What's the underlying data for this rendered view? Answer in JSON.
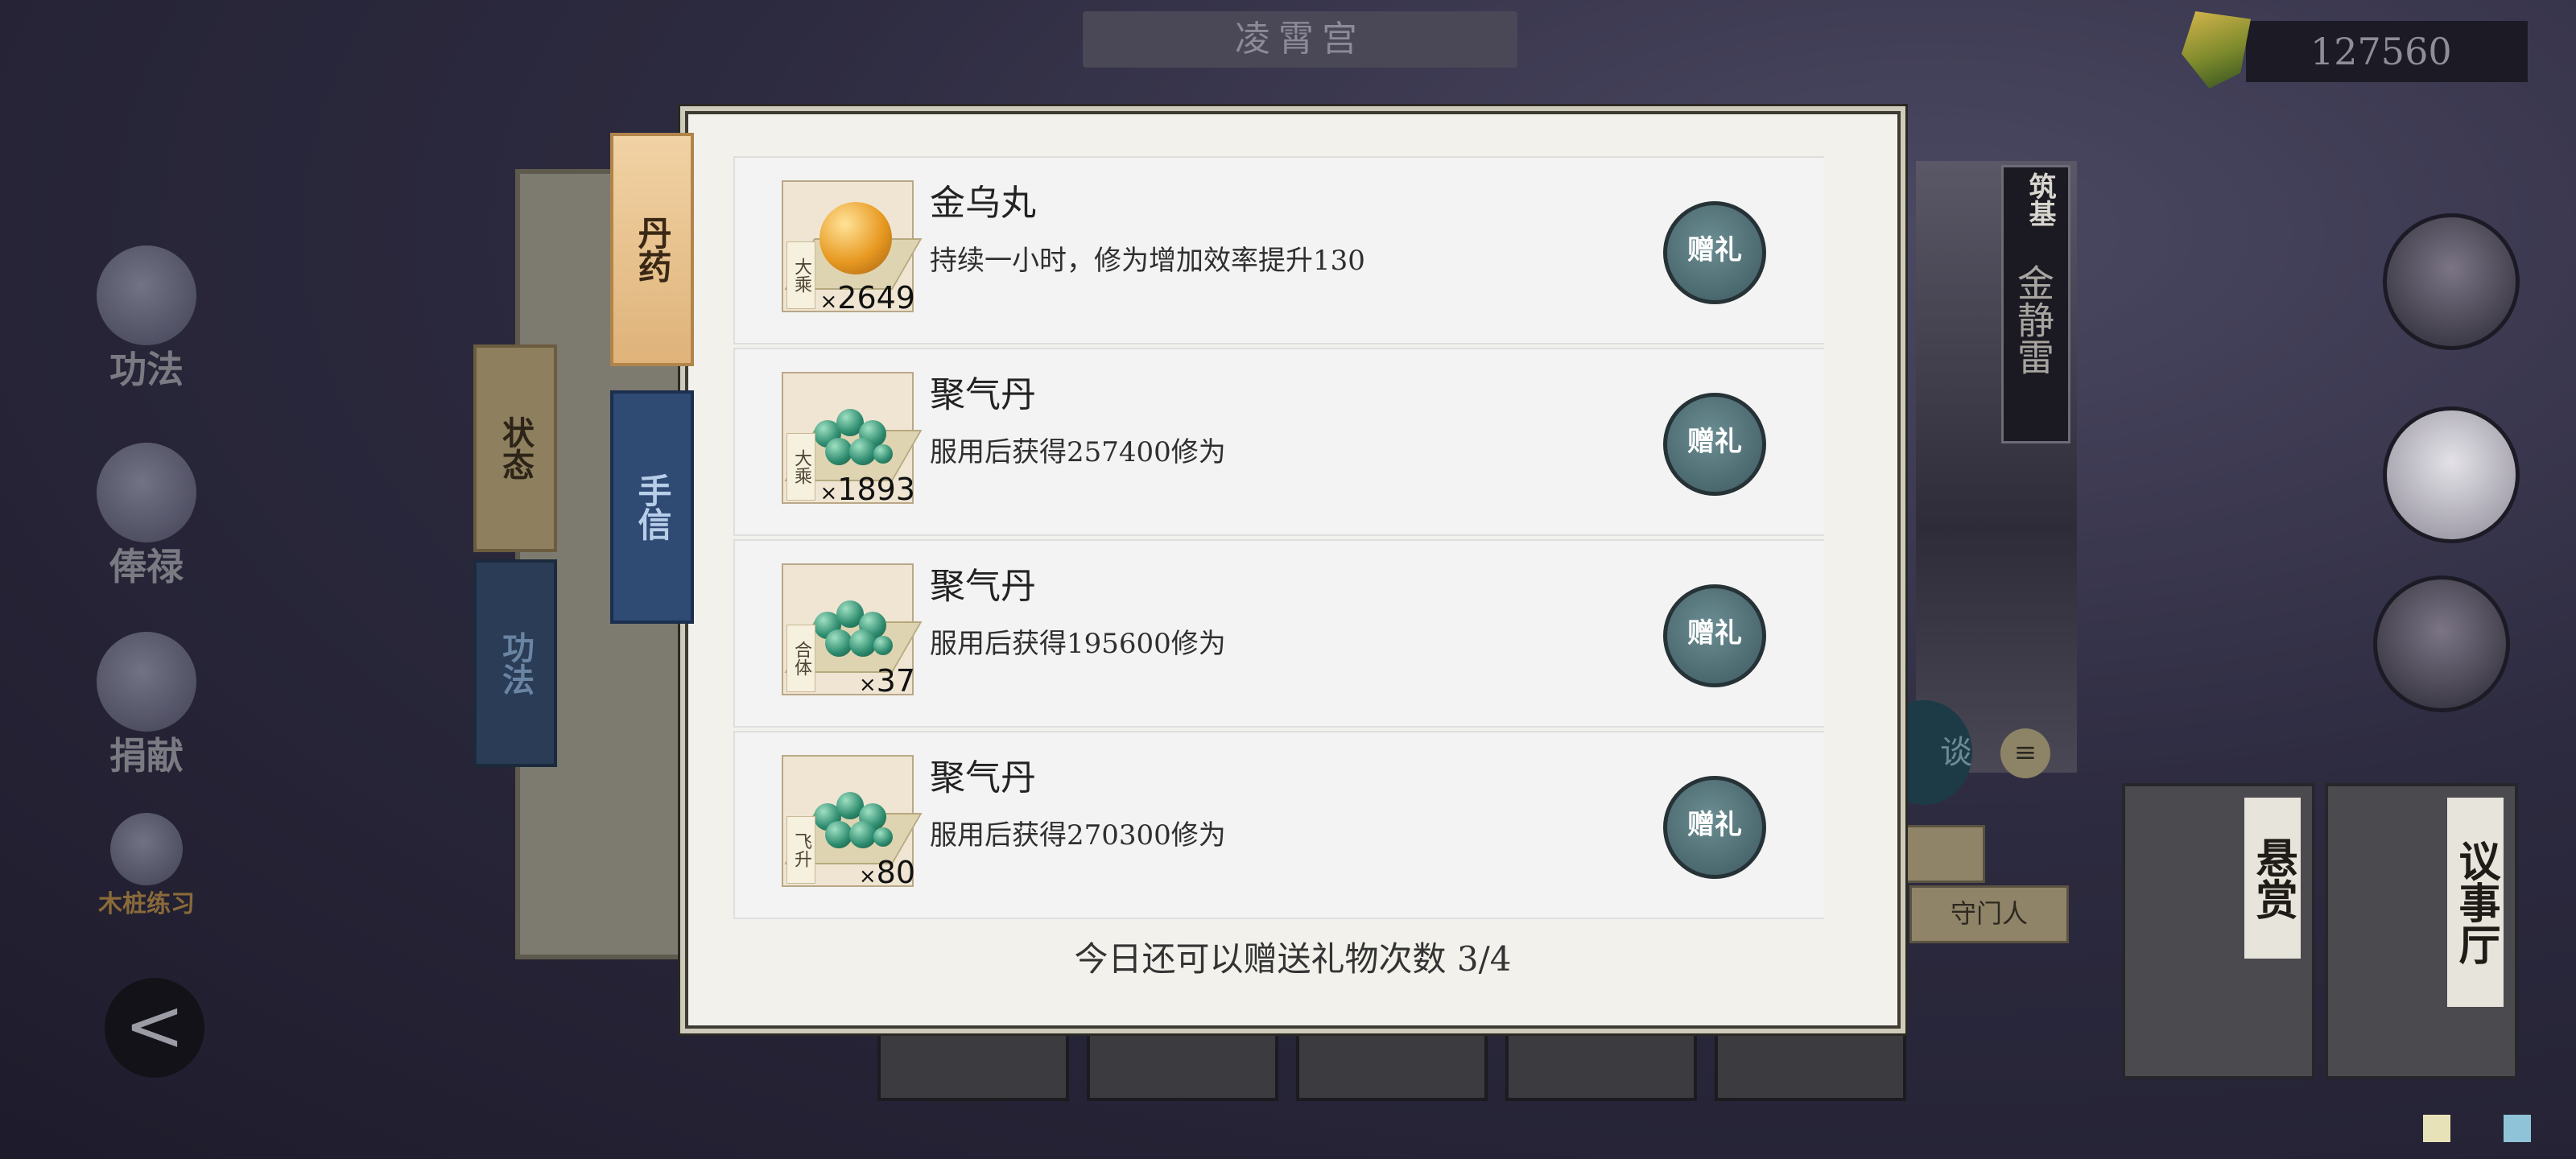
{
  "header": {
    "location_title": "凌霄宫",
    "currency_value": "127560",
    "currency_icon": "jade-token-icon"
  },
  "left_menu": [
    {
      "label": "功法",
      "icon": "scroll-icon"
    },
    {
      "label": "俸禄",
      "icon": "hand-icon"
    },
    {
      "label": "捐献",
      "icon": "pouch-icon"
    },
    {
      "label": "木桩练习",
      "icon": "wood-dummy-icon"
    }
  ],
  "back_label": "<",
  "side_tabs": {
    "state": "状态",
    "gongfa": "功法"
  },
  "dialog_tabs": {
    "danyao": "丹药",
    "shouxin": "手信"
  },
  "items": [
    {
      "name": "金乌丸",
      "desc": "持续一小时，修为增加效率提升130",
      "rank": "大乘",
      "count": "2649",
      "icon": "golden-pill-icon",
      "button": "赠礼"
    },
    {
      "name": "聚气丹",
      "desc": "服用后获得257400修为",
      "rank": "大乘",
      "count": "1893",
      "icon": "green-pills-icon",
      "button": "赠礼"
    },
    {
      "name": "聚气丹",
      "desc": "服用后获得195600修为",
      "rank": "合体",
      "count": "37",
      "icon": "green-pills-icon",
      "button": "赠礼"
    },
    {
      "name": "聚气丹",
      "desc": "服用后获得270300修为",
      "rank": "飞升",
      "count": "80",
      "icon": "green-pills-icon",
      "button": "赠礼"
    }
  ],
  "count_prefix": "×",
  "footer": "今日还可以赠送礼物次数 3/4",
  "character": {
    "title": "筑基",
    "name": "金静雷",
    "chat_label": "谈",
    "menu_icon": "menu-icon"
  },
  "cards": [
    {
      "label": "悬赏"
    },
    {
      "label": "议事厅"
    }
  ],
  "gate_button": "守门人"
}
